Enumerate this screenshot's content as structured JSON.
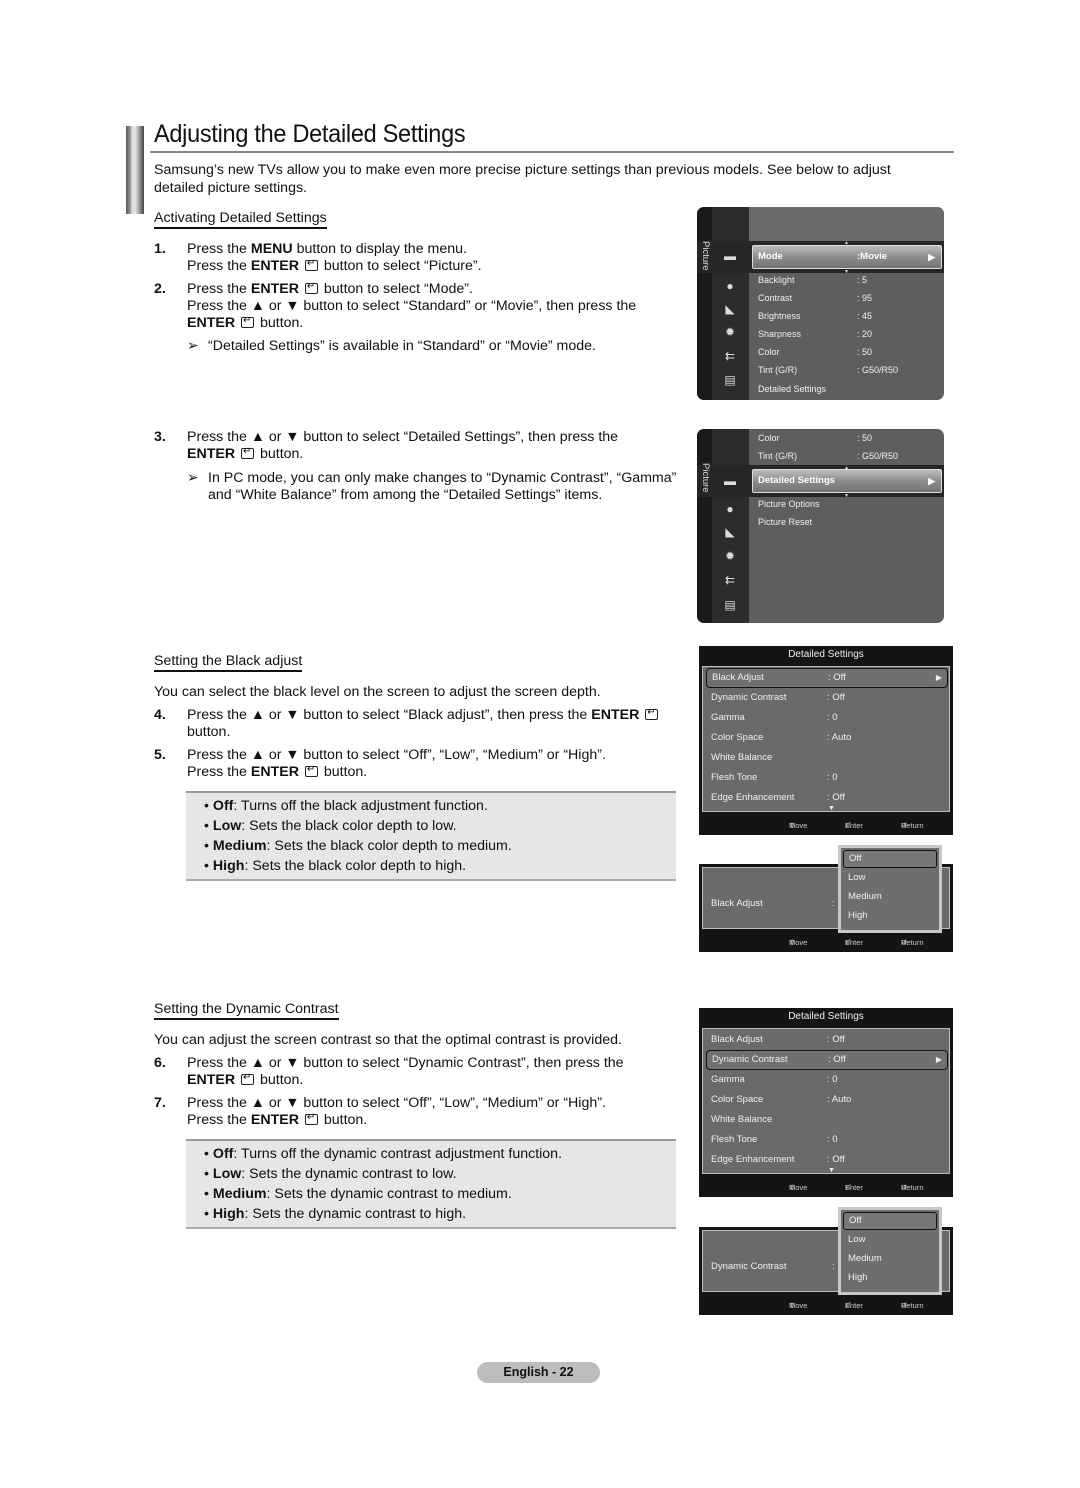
{
  "page": {
    "title": "Adjusting the Detailed Settings",
    "intro": "Samsung’s new TVs allow you to make even more precise picture settings than previous models. See below to adjust detailed picture settings.",
    "footer": "English - 22"
  },
  "sections": {
    "activating": {
      "heading": "Activating Detailed Settings",
      "steps": [
        {
          "num": "1.",
          "lines": [
            "Press the <b>MENU</b> button to display the menu.",
            "Press the <b>ENTER</b> [enter] button to select “Picture”."
          ]
        },
        {
          "num": "2.",
          "lines": [
            "Press the <b>ENTER</b> [enter] button to select “Mode”.",
            "Press the ▲ or ▼ button to select “Standard” or “Movie”, then press the",
            "<b>ENTER</b> [enter] button."
          ]
        },
        {
          "num": "3.",
          "lines": [
            "Press the ▲ or ▼ button to select “Detailed Settings”, then press the",
            "<b>ENTER</b> [enter] button."
          ]
        }
      ],
      "notes": [
        "“Detailed Settings” is available in “Standard” or “Movie” mode.",
        "In PC mode, you can only make changes to “Dynamic Contrast”, “Gamma” and “White Balance” from among the “Detailed Settings” items."
      ],
      "note_marker": "➢"
    },
    "black_adjust": {
      "heading": "Setting the Black adjust",
      "intro": "You can select the black level on the screen to adjust the screen depth.",
      "steps": [
        {
          "num": "4.",
          "lines": [
            "Press the ▲ or ▼ button to select “Black adjust”, then press the <b>ENTER</b> [enter]",
            "button."
          ]
        },
        {
          "num": "5.",
          "lines": [
            "Press the ▲ or ▼ button to select “Off”, “Low”, “Medium” or “High”.",
            "Press the <b>ENTER</b> [enter] button."
          ]
        }
      ],
      "bullets": [
        {
          "term": "Off",
          "desc": ": Turns off the black adjustment function."
        },
        {
          "term": "Low",
          "desc": ": Sets the black color depth to low."
        },
        {
          "term": "Medium",
          "desc": ": Sets the black color depth to medium."
        },
        {
          "term": "High",
          "desc": ": Sets the black color depth to high."
        }
      ]
    },
    "dynamic_contrast": {
      "heading": "Setting the Dynamic Contrast",
      "intro": "You can adjust the screen contrast so that the optimal contrast is provided.",
      "steps": [
        {
          "num": "6.",
          "lines": [
            "Press the ▲ or ▼ button to select “Dynamic Contrast”, then press the",
            "<b>ENTER</b> [enter] button."
          ]
        },
        {
          "num": "7.",
          "lines": [
            "Press the ▲ or ▼ button to select “Off”, “Low”, “Medium” or “High”.",
            "Press the <b>ENTER</b> [enter] button."
          ]
        }
      ],
      "bullets": [
        {
          "term": "Off",
          "desc": ": Turns off the dynamic contrast adjustment function."
        },
        {
          "term": "Low",
          "desc": ": Sets the dynamic contrast to low."
        },
        {
          "term": "Medium",
          "desc": ": Sets the dynamic contrast to medium."
        },
        {
          "term": "High",
          "desc": ": Sets the dynamic contrast to high."
        }
      ]
    }
  },
  "osd": {
    "tab_label": "Picture",
    "icons": [
      "picture-icon",
      "sound-icon",
      "channel-icon",
      "setup-icon",
      "input-icon",
      "application-icon"
    ],
    "picture_menu_1": {
      "selected": {
        "label": "Mode",
        "value": ":Movie"
      },
      "items": [
        {
          "label": "Backlight",
          "value": ": 5"
        },
        {
          "label": "Contrast",
          "value": ": 95"
        },
        {
          "label": "Brightness",
          "value": ": 45"
        },
        {
          "label": "Sharpness",
          "value": ": 20"
        },
        {
          "label": "Color",
          "value": ": 50"
        },
        {
          "label": "Tint (G/R)",
          "value": ": G50/R50"
        },
        {
          "label": "Detailed Settings",
          "value": ""
        }
      ]
    },
    "picture_menu_2": {
      "above": [
        {
          "label": "Color",
          "value": ": 50"
        },
        {
          "label": "Tint (G/R)",
          "value": ": G50/R50"
        }
      ],
      "selected": {
        "label": "Detailed Settings",
        "value": ""
      },
      "items": [
        {
          "label": "Picture Options",
          "value": ""
        },
        {
          "label": "Picture Reset",
          "value": ""
        }
      ]
    },
    "detailed_settings": {
      "title": "Detailed Settings",
      "items": [
        {
          "label": "Black Adjust",
          "value": ": Off"
        },
        {
          "label": "Dynamic Contrast",
          "value": ": Off"
        },
        {
          "label": "Gamma",
          "value": ": 0"
        },
        {
          "label": "Color Space",
          "value": ": Auto"
        },
        {
          "label": "White Balance",
          "value": ""
        },
        {
          "label": "Flesh Tone",
          "value": ": 0"
        },
        {
          "label": "Edge Enhancement",
          "value": ": Off"
        }
      ]
    },
    "footer": {
      "move": "Move",
      "enter": "Enter",
      "return": "Return"
    },
    "black_adjust_popup": {
      "label": "Black Adjust",
      "colon": ":",
      "options": [
        "Off",
        "Low",
        "Medium",
        "High"
      ],
      "selected": "Off"
    },
    "dynamic_contrast_popup": {
      "label": "Dynamic Contrast",
      "colon": ":",
      "options": [
        "Off",
        "Low",
        "Medium",
        "High"
      ],
      "selected": "Off"
    }
  }
}
